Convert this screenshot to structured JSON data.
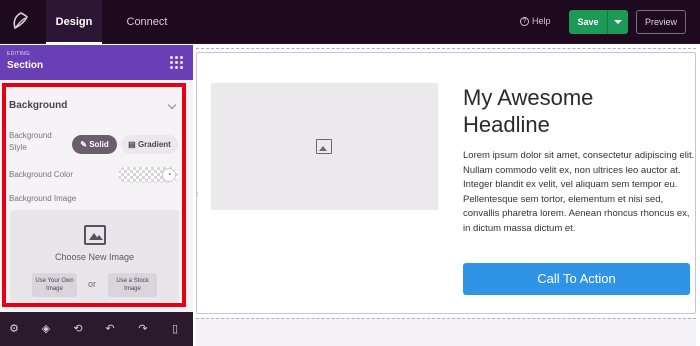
{
  "topbar": {
    "tabs": [
      {
        "label": "Design",
        "active": true
      },
      {
        "label": "Connect",
        "active": false
      }
    ],
    "help_label": "Help",
    "save_label": "Save",
    "preview_label": "Preview"
  },
  "sidebar": {
    "editing_small": "EDITING:",
    "editing_title": "Section",
    "background": {
      "title": "Background",
      "style_label": "Background Style",
      "solid_label": "Solid",
      "gradient_label": "Gradient",
      "color_label": "Background Color",
      "image_label": "Background Image",
      "choose_image": "Choose New Image",
      "use_own": "Use Your Own Image",
      "or_label": "or",
      "use_stock": "Use a Stock Image"
    },
    "bottom_icons": [
      "gear-icon",
      "layers-icon",
      "history-icon",
      "undo-icon",
      "redo-icon",
      "mobile-icon"
    ]
  },
  "canvas": {
    "headline": "My Awesome Headline",
    "body": "Lorem ipsum dolor sit amet, consectetur adipiscing elit. Nullam commodo velit ex, non ultrices leo auctor at. Integer blandit ex velit, vel aliquam sem tempor eu. Pellentesque sem tortor, elementum et nisi sed, convallis pharetra lorem. Aenean rhoncus rhoncus ex, in dictum massa dictum et.",
    "cta_label": "Call To Action"
  },
  "colors": {
    "topbar_bg": "#1d0a1f",
    "editing_bg": "#6a3fb5",
    "save_green": "#1c9a56",
    "cta_blue": "#2f93e6",
    "highlight_red": "#e60012"
  }
}
